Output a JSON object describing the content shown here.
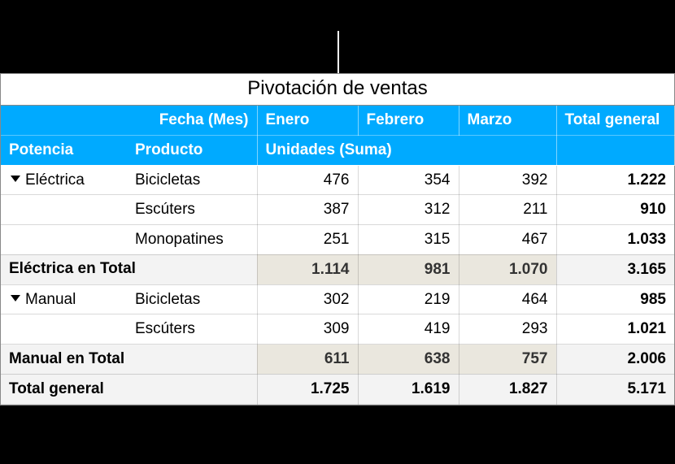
{
  "title": "Pivotación de ventas",
  "headers": {
    "fecha_label": "Fecha (Mes)",
    "months": {
      "m1": "Enero",
      "m2": "Febrero",
      "m3": "Marzo"
    },
    "total_general": "Total general",
    "potencia": "Potencia",
    "producto": "Producto",
    "unidades": "Unidades (Suma)"
  },
  "groups": {
    "electrica": {
      "name": "Eléctrica",
      "subtotal_label": "Eléctrica en Total",
      "rows": {
        "r0": {
          "product": "Bicicletas",
          "m1": "476",
          "m2": "354",
          "m3": "392",
          "total": "1.222"
        },
        "r1": {
          "product": "Escúters",
          "m1": "387",
          "m2": "312",
          "m3": "211",
          "total": "910"
        },
        "r2": {
          "product": "Monopatines",
          "m1": "251",
          "m2": "315",
          "m3": "467",
          "total": "1.033"
        }
      },
      "subtotal": {
        "m1": "1.114",
        "m2": "981",
        "m3": "1.070",
        "total": "3.165"
      }
    },
    "manual": {
      "name": "Manual",
      "subtotal_label": "Manual en Total",
      "rows": {
        "r0": {
          "product": "Bicicletas",
          "m1": "302",
          "m2": "219",
          "m3": "464",
          "total": "985"
        },
        "r1": {
          "product": "Escúters",
          "m1": "309",
          "m2": "419",
          "m3": "293",
          "total": "1.021"
        }
      },
      "subtotal": {
        "m1": "611",
        "m2": "638",
        "m3": "757",
        "total": "2.006"
      }
    }
  },
  "grand_total": {
    "label": "Total general",
    "m1": "1.725",
    "m2": "1.619",
    "m3": "1.827",
    "total": "5.171"
  }
}
